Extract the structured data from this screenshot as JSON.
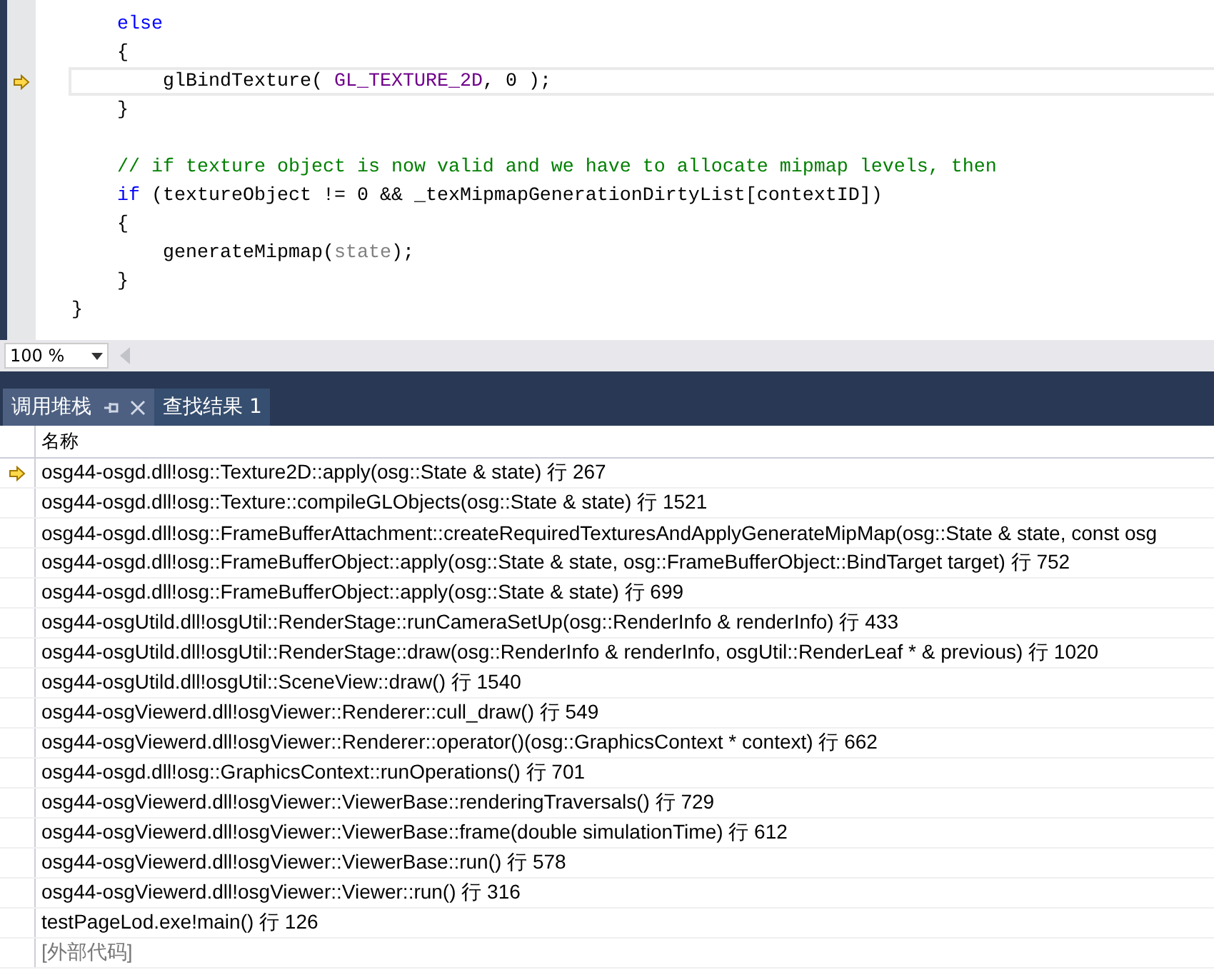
{
  "editor": {
    "lines": [
      {
        "current": false,
        "tokens": [
          {
            "kind": "keyword",
            "text": "    else"
          }
        ]
      },
      {
        "current": false,
        "tokens": [
          {
            "kind": "plain",
            "text": "    {"
          }
        ]
      },
      {
        "current": true,
        "tokens": [
          {
            "kind": "plain",
            "text": "        glBindTexture( "
          },
          {
            "kind": "macro",
            "text": "GL_TEXTURE_2D"
          },
          {
            "kind": "plain",
            "text": ", 0 );"
          }
        ]
      },
      {
        "current": false,
        "tokens": [
          {
            "kind": "plain",
            "text": "    }"
          }
        ]
      },
      {
        "current": false
      },
      {
        "current": false,
        "tokens": [
          {
            "kind": "comment",
            "text": "    // if texture object is now valid and we have to allocate mipmap levels, then"
          }
        ]
      },
      {
        "current": false,
        "tokens": [
          {
            "kind": "keyword",
            "text": "    if"
          },
          {
            "kind": "plain",
            "text": " (textureObject != 0 && _texMipmapGenerationDirtyList[contextID])"
          }
        ]
      },
      {
        "current": false,
        "tokens": [
          {
            "kind": "plain",
            "text": "    {"
          }
        ]
      },
      {
        "current": false,
        "tokens": [
          {
            "kind": "plain",
            "text": "        generateMipmap("
          },
          {
            "kind": "param",
            "text": "state"
          },
          {
            "kind": "plain",
            "text": ");"
          }
        ]
      },
      {
        "current": false,
        "tokens": [
          {
            "kind": "plain",
            "text": "    }"
          }
        ]
      },
      {
        "current": false,
        "tokens": [
          {
            "kind": "plain",
            "text": "}"
          }
        ]
      }
    ],
    "zoom": "100 %"
  },
  "panel": {
    "tabs": [
      {
        "label": "调用堆栈",
        "selected": true
      },
      {
        "label": "查找结果 1",
        "selected": false
      }
    ],
    "column": "名称",
    "rows": [
      {
        "text": "osg44-osgd.dll!osg::Texture2D::apply(osg::State & state) 行 267",
        "current": true,
        "external": false
      },
      {
        "text": "osg44-osgd.dll!osg::Texture::compileGLObjects(osg::State & state) 行 1521",
        "current": false,
        "external": false
      },
      {
        "text": "osg44-osgd.dll!osg::FrameBufferAttachment::createRequiredTexturesAndApplyGenerateMipMap(osg::State & state, const osg",
        "current": false,
        "external": false
      },
      {
        "text": "osg44-osgd.dll!osg::FrameBufferObject::apply(osg::State & state, osg::FrameBufferObject::BindTarget target) 行 752",
        "current": false,
        "external": false
      },
      {
        "text": "osg44-osgd.dll!osg::FrameBufferObject::apply(osg::State & state) 行 699",
        "current": false,
        "external": false
      },
      {
        "text": "osg44-osgUtild.dll!osgUtil::RenderStage::runCameraSetUp(osg::RenderInfo & renderInfo) 行 433",
        "current": false,
        "external": false
      },
      {
        "text": "osg44-osgUtild.dll!osgUtil::RenderStage::draw(osg::RenderInfo & renderInfo, osgUtil::RenderLeaf * & previous) 行 1020",
        "current": false,
        "external": false
      },
      {
        "text": "osg44-osgUtild.dll!osgUtil::SceneView::draw() 行 1540",
        "current": false,
        "external": false
      },
      {
        "text": "osg44-osgViewerd.dll!osgViewer::Renderer::cull_draw() 行 549",
        "current": false,
        "external": false
      },
      {
        "text": "osg44-osgViewerd.dll!osgViewer::Renderer::operator()(osg::GraphicsContext * context) 行 662",
        "current": false,
        "external": false
      },
      {
        "text": "osg44-osgd.dll!osg::GraphicsContext::runOperations() 行 701",
        "current": false,
        "external": false
      },
      {
        "text": "osg44-osgViewerd.dll!osgViewer::ViewerBase::renderingTraversals() 行 729",
        "current": false,
        "external": false
      },
      {
        "text": "osg44-osgViewerd.dll!osgViewer::ViewerBase::frame(double simulationTime) 行 612",
        "current": false,
        "external": false
      },
      {
        "text": "osg44-osgViewerd.dll!osgViewer::ViewerBase::run() 行 578",
        "current": false,
        "external": false
      },
      {
        "text": "osg44-osgViewerd.dll!osgViewer::Viewer::run() 行 316",
        "current": false,
        "external": false
      },
      {
        "text": "testPageLod.exe!main() 行 126",
        "current": false,
        "external": false
      },
      {
        "text": "[外部代码]",
        "current": false,
        "external": true
      }
    ]
  }
}
